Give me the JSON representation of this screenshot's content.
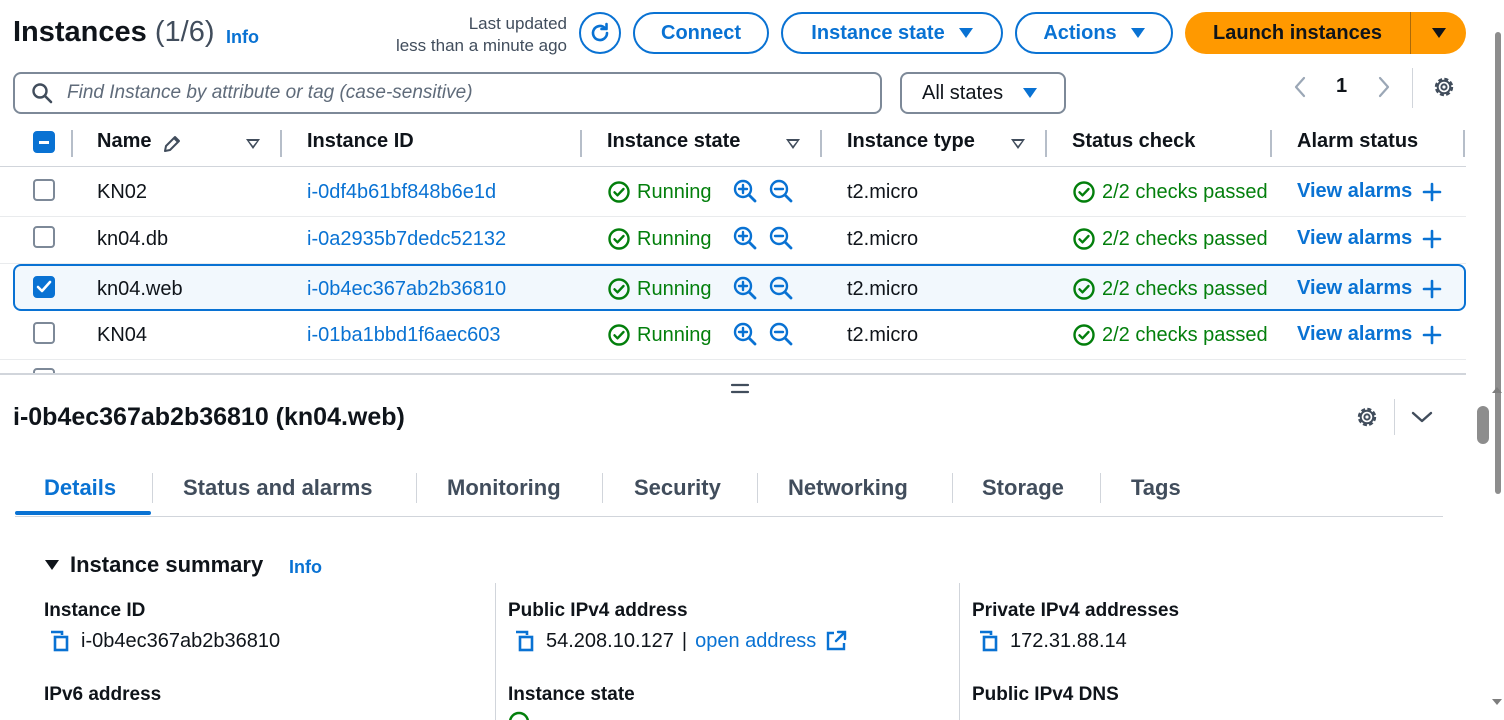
{
  "header": {
    "title": "Instances",
    "count": "(1/6)",
    "info": "Info",
    "last_updated_line1": "Last updated",
    "last_updated_line2": "less than a minute ago",
    "connect": "Connect",
    "instance_state": "Instance state",
    "actions": "Actions",
    "launch": "Launch instances"
  },
  "filter": {
    "placeholder": "Find Instance by attribute or tag (case-sensitive)",
    "state_select": "All states"
  },
  "pagination": {
    "page": "1"
  },
  "table": {
    "columns": {
      "name": "Name",
      "instance_id": "Instance ID",
      "instance_state": "Instance state",
      "instance_type": "Instance type",
      "status_check": "Status check",
      "alarm_status": "Alarm status"
    },
    "rows": [
      {
        "name": "KN02",
        "id": "i-0df4b61bf848b6e1d",
        "state": "Running",
        "type": "t2.micro",
        "status": "2/2 checks passed",
        "alarms": "View alarms",
        "selected": false
      },
      {
        "name": "kn04.db",
        "id": "i-0a2935b7dedc52132",
        "state": "Running",
        "type": "t2.micro",
        "status": "2/2 checks passed",
        "alarms": "View alarms",
        "selected": false
      },
      {
        "name": "kn04.web",
        "id": "i-0b4ec367ab2b36810",
        "state": "Running",
        "type": "t2.micro",
        "status": "2/2 checks passed",
        "alarms": "View alarms",
        "selected": true
      },
      {
        "name": "KN04",
        "id": "i-01ba1bbd1f6aec603",
        "state": "Running",
        "type": "t2.micro",
        "status": "2/2 checks passed",
        "alarms": "View alarms",
        "selected": false
      }
    ]
  },
  "details": {
    "title": "i-0b4ec367ab2b36810 (kn04.web)",
    "tabs": [
      "Details",
      "Status and alarms",
      "Monitoring",
      "Security",
      "Networking",
      "Storage",
      "Tags"
    ],
    "active_tab": "Details",
    "summary_title": "Instance summary",
    "summary_info": "Info",
    "fields": {
      "instance_id_label": "Instance ID",
      "instance_id": "i-0b4ec367ab2b36810",
      "public_ipv4_label": "Public IPv4 address",
      "public_ipv4": "54.208.10.127",
      "open_address": "open address",
      "private_ipv4_label": "Private IPv4 addresses",
      "private_ipv4": "172.31.88.14",
      "ipv6_label": "IPv6 address",
      "instance_state_label": "Instance state",
      "public_dns_label": "Public IPv4 DNS"
    }
  },
  "colors": {
    "accent": "#0972d3",
    "launch": "#ff9900",
    "success": "#037f0c"
  }
}
